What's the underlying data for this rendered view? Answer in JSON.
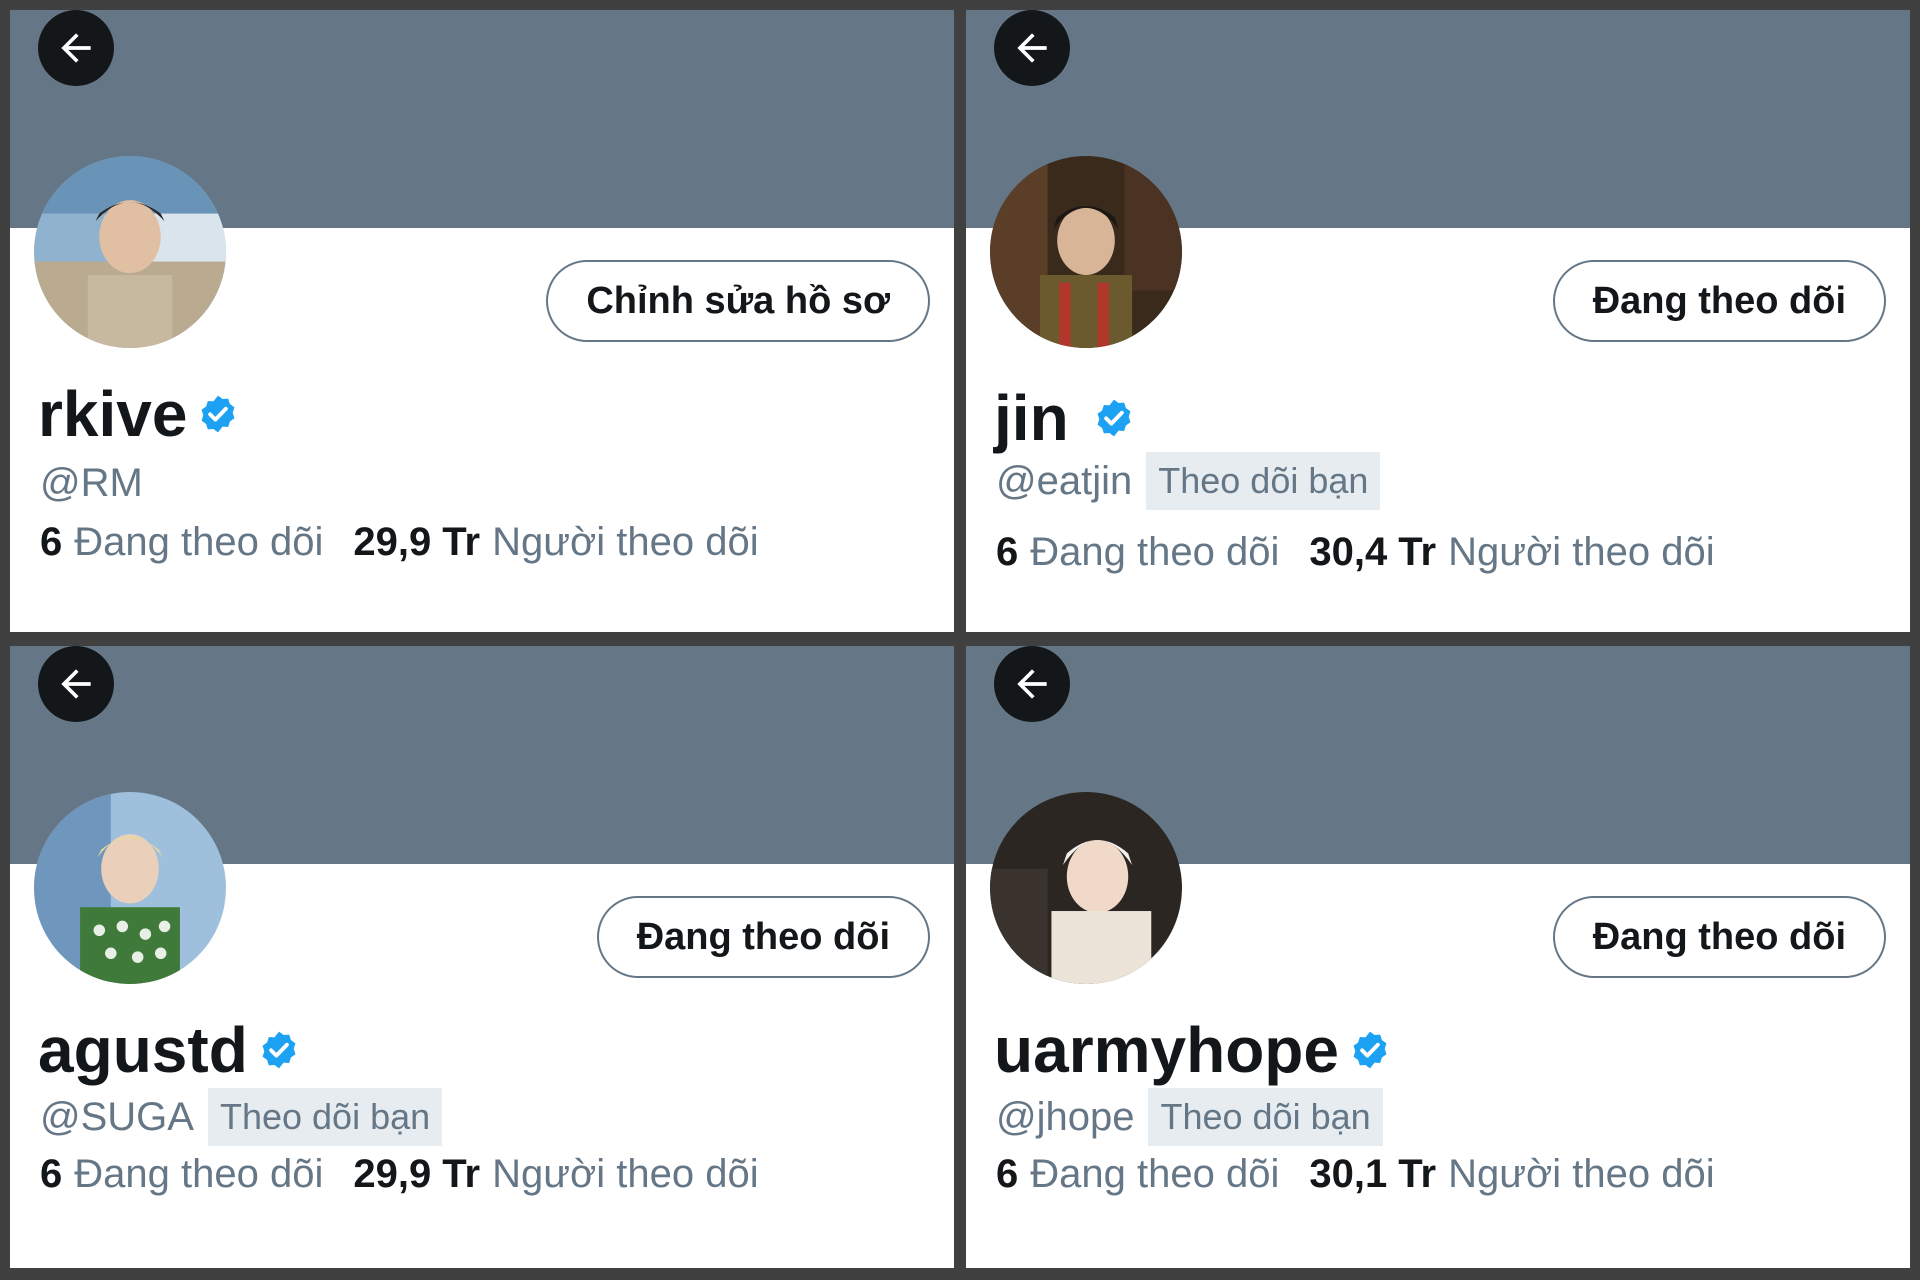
{
  "panels": [
    {
      "display_name": "rkive",
      "handle": "@RM",
      "follows_you": "",
      "action_button": "Chỉnh sửa hồ sơ",
      "following_count": "6",
      "following_label": "Đang theo dõi",
      "followers_count": "29,9 Tr",
      "followers_label": "Người theo dõi",
      "verified": true
    },
    {
      "display_name": "jin",
      "handle": "@eatjin",
      "follows_you": "Theo dõi bạn",
      "action_button": "Đang theo dõi",
      "following_count": "6",
      "following_label": "Đang theo dõi",
      "followers_count": "30,4 Tr",
      "followers_label": "Người theo dõi",
      "verified": true
    },
    {
      "display_name": "agustd",
      "handle": "@SUGA",
      "follows_you": "Theo dõi bạn",
      "action_button": "Đang theo dõi",
      "following_count": "6",
      "following_label": "Đang theo dõi",
      "followers_count": "29,9 Tr",
      "followers_label": "Người theo dõi",
      "verified": true
    },
    {
      "display_name": "uarmyhope",
      "handle": "@jhope",
      "follows_you": "Theo dõi bạn",
      "action_button": "Đang theo dõi",
      "following_count": "6",
      "following_label": "Đang theo dõi",
      "followers_count": "30,1 Tr",
      "followers_label": "Người theo dõi",
      "verified": true
    }
  ],
  "icons": {
    "back": "arrow-left-icon",
    "verified": "verified-badge-icon"
  },
  "colors": {
    "banner": "#657786",
    "verified": "#1da1f2",
    "text_primary": "#14171a",
    "text_secondary": "#657786",
    "badge_bg": "#e6ecf0",
    "background": "#404040"
  }
}
